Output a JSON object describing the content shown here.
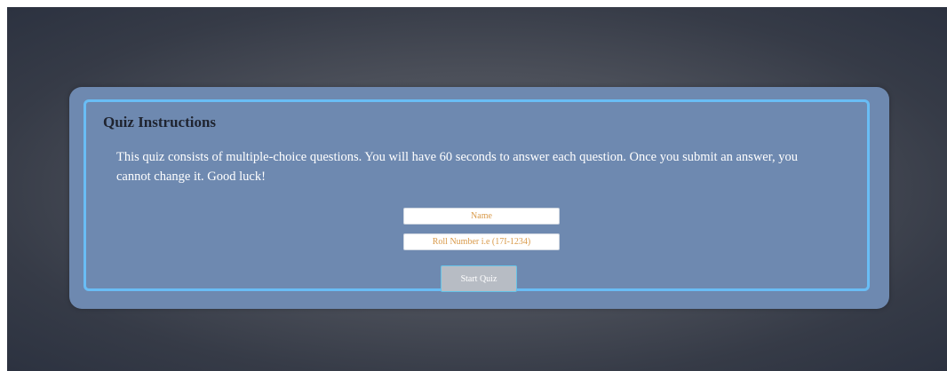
{
  "quiz": {
    "title": "Quiz Instructions",
    "description": "This quiz consists of multiple-choice questions. You will have 60 seconds to answer each question. Once you submit an answer, you cannot change it. Good luck!",
    "name_placeholder": "Name",
    "roll_placeholder": "Roll Number i.e (17I-1234)",
    "start_label": "Start Quiz"
  },
  "colors": {
    "card": "#6e89b0",
    "card_border": "#69bdf5",
    "placeholder_text": "#d99a4a",
    "button_bg": "#b7bcc4"
  }
}
